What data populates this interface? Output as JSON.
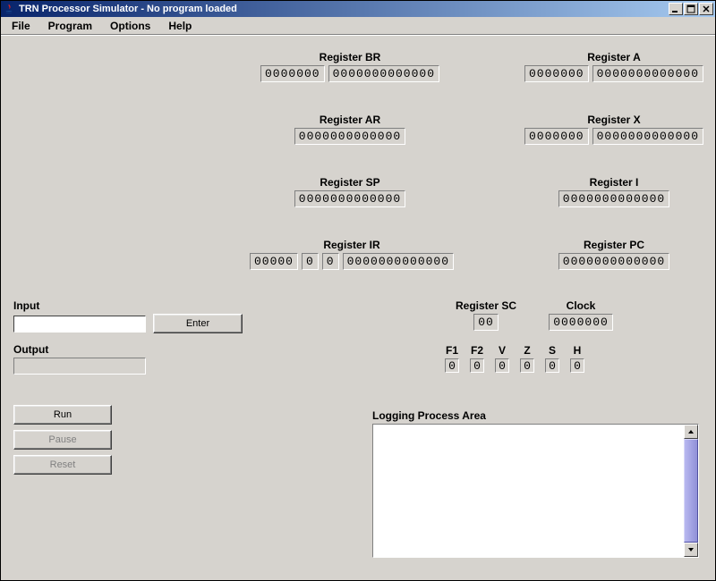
{
  "titlebar": {
    "title": "TRN Processor Simulator - No program loaded"
  },
  "menu": {
    "file": "File",
    "program": "Program",
    "options": "Options",
    "help": "Help"
  },
  "registers": {
    "br": {
      "label": "Register BR",
      "hi": "0000000",
      "lo": "0000000000000"
    },
    "a": {
      "label": "Register A",
      "hi": "0000000",
      "lo": "0000000000000"
    },
    "ar": {
      "label": "Register AR",
      "val": "0000000000000"
    },
    "x": {
      "label": "Register X",
      "hi": "0000000",
      "lo": "0000000000000"
    },
    "sp": {
      "label": "Register SP",
      "val": "0000000000000"
    },
    "i": {
      "label": "Register I",
      "val": "0000000000000"
    },
    "ir": {
      "label": "Register IR",
      "a": "00000",
      "b": "0",
      "c": "0",
      "d": "0000000000000"
    },
    "pc": {
      "label": "Register PC",
      "val": "0000000000000"
    },
    "sc": {
      "label": "Register SC",
      "val": "00"
    },
    "clock": {
      "label": "Clock",
      "val": "0000000"
    }
  },
  "flags": {
    "f1": {
      "label": "F1",
      "val": "0"
    },
    "f2": {
      "label": "F2",
      "val": "0"
    },
    "v": {
      "label": "V",
      "val": "0"
    },
    "z": {
      "label": "Z",
      "val": "0"
    },
    "s": {
      "label": "S",
      "val": "0"
    },
    "h": {
      "label": "H",
      "val": "0"
    }
  },
  "io": {
    "input_label": "Input",
    "enter_label": "Enter",
    "output_label": "Output"
  },
  "buttons": {
    "run": "Run",
    "pause": "Pause",
    "reset": "Reset"
  },
  "log": {
    "label": "Logging Process Area"
  }
}
